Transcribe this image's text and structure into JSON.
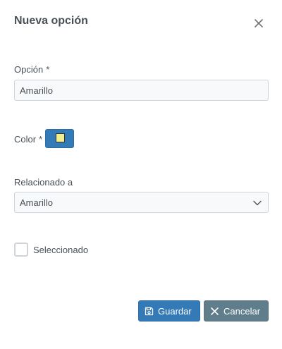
{
  "dialog": {
    "title": "Nueva opción",
    "close_icon": "close-icon"
  },
  "fields": {
    "option": {
      "label": "Opción",
      "required_mark": "*",
      "value": "Amarillo"
    },
    "color": {
      "label": "Color",
      "required_mark": "*",
      "swatch_color": "#f4ef8d",
      "button_color": "#337ab7"
    },
    "related": {
      "label": "Relacionado a",
      "selected": "Amarillo",
      "chevron_icon": "chevron-down-icon"
    },
    "selected_checkbox": {
      "label": "Seleccionado",
      "checked": false
    }
  },
  "buttons": {
    "save": {
      "label": "Guardar",
      "icon": "save-icon",
      "color": "#337ab7"
    },
    "cancel": {
      "label": "Cancelar",
      "icon": "close-icon",
      "color": "#607d8b"
    }
  }
}
